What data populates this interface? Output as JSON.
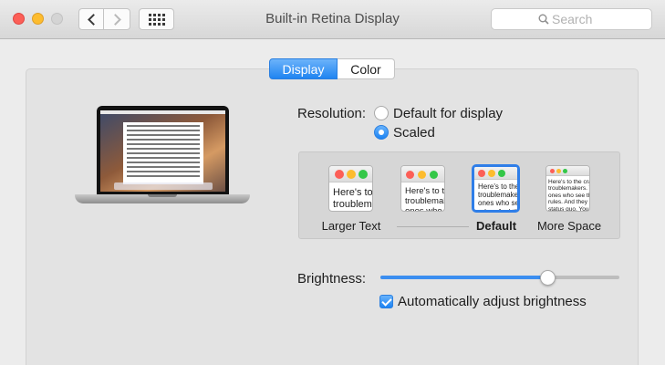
{
  "window": {
    "title": "Built-in Retina Display",
    "search_placeholder": "Search"
  },
  "tabs": [
    {
      "label": "Display",
      "selected": true
    },
    {
      "label": "Color",
      "selected": false
    }
  ],
  "resolution": {
    "label": "Resolution:",
    "options": [
      {
        "label": "Default for display",
        "selected": false
      },
      {
        "label": "Scaled",
        "selected": true
      }
    ]
  },
  "scaled": {
    "previews": [
      {
        "label": "Larger Text",
        "sample": "Here's to\ntroublem",
        "selected": false
      },
      {
        "label": "",
        "sample": "Here's to th\ntroublemakers\nones who see",
        "selected": false
      },
      {
        "label": "Default",
        "sample": "Here's to the cr\ntroublemakers.\nones who see th\nrules. And they",
        "selected": true
      },
      {
        "label": "More Space",
        "sample": "Here's to the crazy\ntroublemakers. The\nones who see things d\nrules. And they have\nstatus quo. You can",
        "selected": false
      }
    ]
  },
  "brightness": {
    "label": "Brightness:",
    "level": 0.7,
    "auto_label": "Automatically adjust brightness",
    "auto_checked": true
  },
  "colors": {
    "accent": "#1f84f1",
    "close": "#fc5f57",
    "minimize": "#fdbc2e",
    "zoom_disabled": "#d4d4d4"
  }
}
